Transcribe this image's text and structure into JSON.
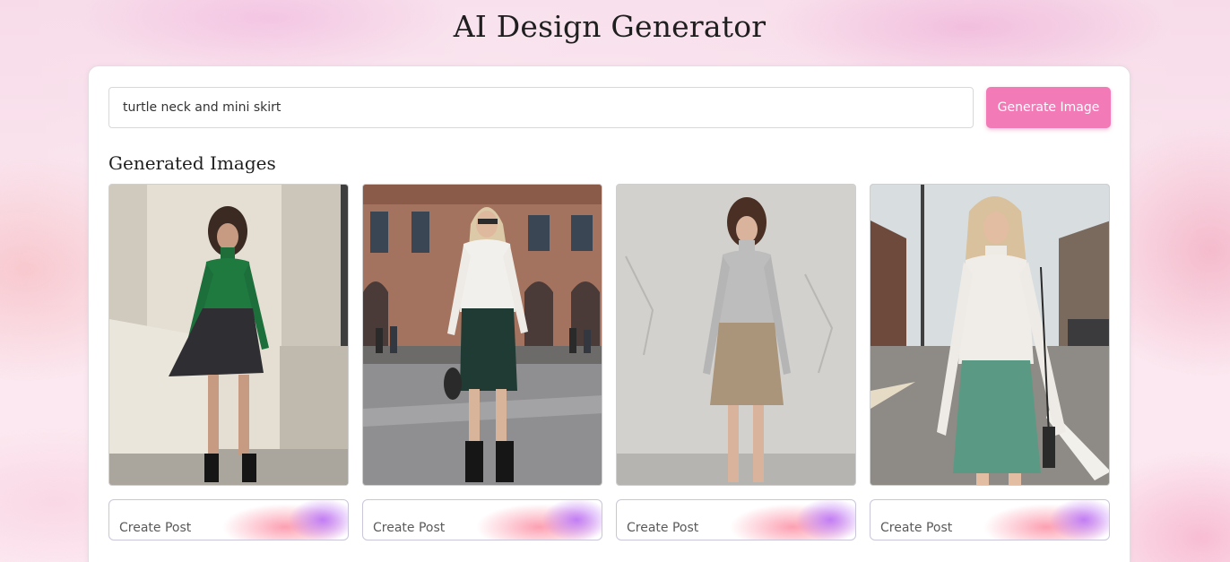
{
  "header": {
    "title": "AI Design Generator"
  },
  "prompt": {
    "value": "turtle neck and mini skirt",
    "button_label": "Generate Image"
  },
  "gallery": {
    "heading": "Generated Images",
    "items": [
      {
        "alt": "Model in green turtleneck and dark pleated mini skirt",
        "button_label": "Create Post"
      },
      {
        "alt": "Model in white turtleneck and dark green mini skirt on a city street",
        "button_label": "Create Post"
      },
      {
        "alt": "Model in grey turtleneck and beige pleated mini skirt",
        "button_label": "Create Post"
      },
      {
        "alt": "Model in white turtleneck and teal mini skirt on a road",
        "button_label": "Create Post"
      }
    ]
  },
  "colors": {
    "accent": "#f27bb7",
    "button_text": "#ffffff",
    "card_background": "#ffffff",
    "page_tint": "#fbe7ef"
  }
}
